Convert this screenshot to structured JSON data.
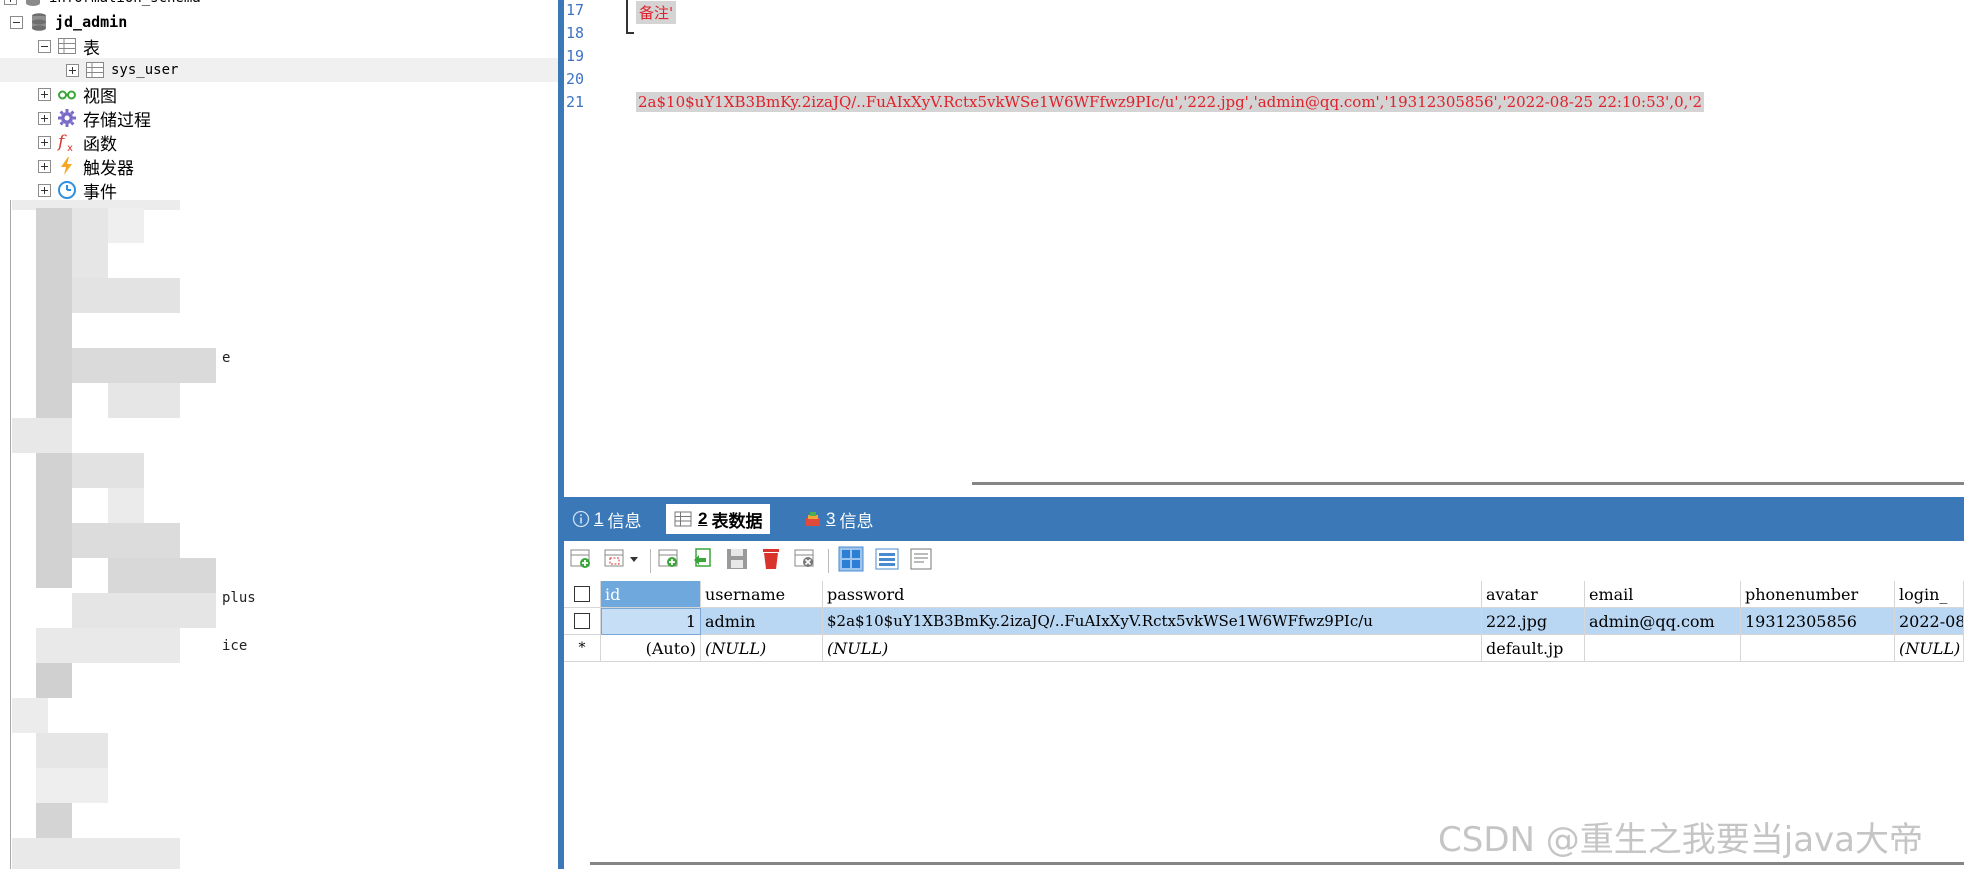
{
  "tree": {
    "cut_top_label": "information_schema",
    "db_label": "jd_admin",
    "tables_label": "表",
    "table_item": "sys_user",
    "views_label": "视图",
    "procs_label": "存储过程",
    "funcs_label": "函数",
    "triggers_label": "触发器",
    "events_label": "事件",
    "frag_e": "e",
    "frag_plus": "plus",
    "frag_ice": "ice"
  },
  "editor": {
    "line_numbers": [
      "17",
      "18",
      "19",
      "20",
      "21"
    ],
    "line17_text": "备注'",
    "line21_text": "2a$10$uY1XB3BmKy.2izaJQ/..FuAIxXyV.Rctx5vkWSe1W6WFfwz9PIc/u','222.jpg','admin@qq.com','19312305856','2022-08-25 22:10:53',0,'2"
  },
  "tabs": [
    {
      "num": "1",
      "label": "信息",
      "icon": "info-icon"
    },
    {
      "num": "2",
      "label": "表数据",
      "icon": "table-icon"
    },
    {
      "num": "3",
      "label": "信息",
      "icon": "info-stack-icon"
    }
  ],
  "grid": {
    "columns": [
      "id",
      "username",
      "password",
      "avatar",
      "email",
      "phonenumber",
      "login_"
    ],
    "rows": [
      {
        "marker": "",
        "id": "1",
        "username": "admin",
        "password": "$2a$10$uY1XB3BmKy.2izaJQ/..FuAIxXyV.Rctx5vkWSe1W6WFfwz9PIc/u",
        "avatar": "222.jpg",
        "email": "admin@qq.com",
        "phonenumber": "19312305856",
        "login": "2022-08"
      },
      {
        "marker": "*",
        "id": "(Auto)",
        "username": "(NULL)",
        "password": "(NULL)",
        "avatar": "default.jp",
        "email": "",
        "phonenumber": "",
        "login": "(NULL)"
      }
    ]
  },
  "watermark": "CSDN @重生之我要当java大帝",
  "colors": {
    "accent": "#3a78b8",
    "code_red": "#e0202a",
    "line_number_blue": "#3e74c2"
  }
}
